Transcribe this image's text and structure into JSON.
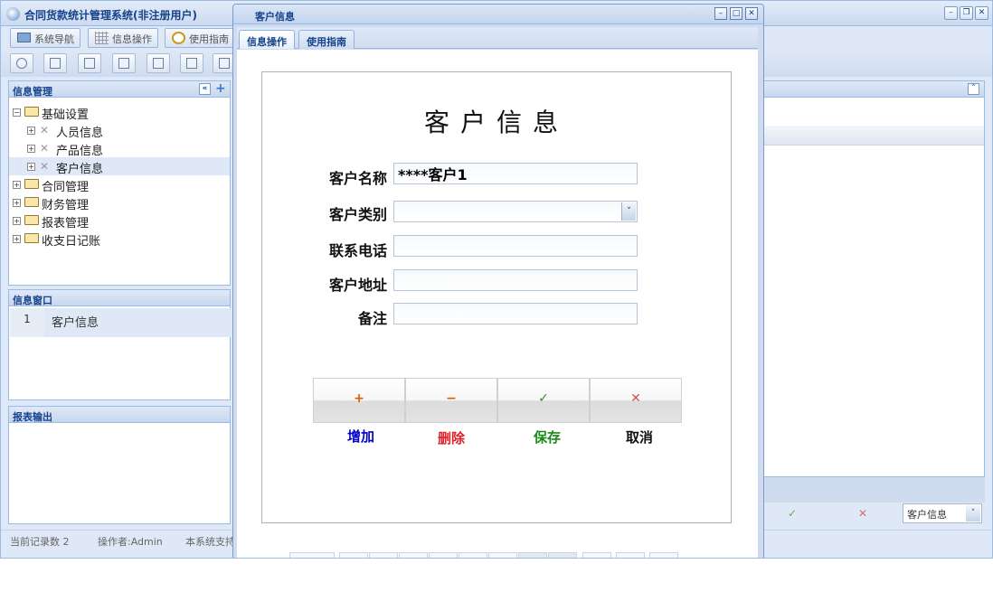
{
  "app": {
    "title": "合同货款统计管理系统(非注册用户)",
    "colors": {
      "accent": "#15428b",
      "panel": "#dfe8f6",
      "border": "#99bbe8"
    }
  },
  "menu": {
    "items": [
      {
        "label": "系统导航",
        "icon": "monitor-icon"
      },
      {
        "label": "信息操作",
        "icon": "grid-icon"
      },
      {
        "label": "使用指南",
        "icon": "clock-icon"
      }
    ]
  },
  "toolbar": {
    "tools": [
      "search-icon",
      "list-icon",
      "document-icon",
      "users-icon",
      "window-icon",
      "export-icon",
      "print-icon"
    ]
  },
  "panels": {
    "info_mgmt": {
      "title": "信息管理",
      "tree": [
        {
          "label": "基础设置",
          "level": 0,
          "type": "folder",
          "expand": "-"
        },
        {
          "label": "人员信息",
          "level": 1,
          "type": "tool",
          "expand": "+"
        },
        {
          "label": "产品信息",
          "level": 1,
          "type": "tool",
          "expand": "+"
        },
        {
          "label": "客户信息",
          "level": 1,
          "type": "tool",
          "expand": "+",
          "selected": true
        },
        {
          "label": "合同管理",
          "level": 0,
          "type": "folder",
          "expand": "+"
        },
        {
          "label": "财务管理",
          "level": 0,
          "type": "folder",
          "expand": "+"
        },
        {
          "label": "报表管理",
          "level": 0,
          "type": "folder",
          "expand": "+"
        },
        {
          "label": "收支日记账",
          "level": 0,
          "type": "folder",
          "expand": "+"
        }
      ]
    },
    "info_window": {
      "title": "信息窗口",
      "rows": [
        {
          "num": "1",
          "text": "客户信息"
        }
      ]
    },
    "report_output": {
      "title": "报表输出"
    }
  },
  "status": {
    "records": "当前记录数 2",
    "operator": "操作者:Admin",
    "support": "本系统支持"
  },
  "right_panel": {
    "select_value": "客户信息"
  },
  "modal": {
    "title": "客户信息",
    "tabs": [
      "信息操作",
      "使用指南"
    ],
    "form": {
      "heading": "客户信息",
      "fields": {
        "name": {
          "label": "客户名称",
          "value": "****客户1"
        },
        "category": {
          "label": "客户类别",
          "value": ""
        },
        "phone": {
          "label": "联系电话",
          "value": ""
        },
        "address": {
          "label": "客户地址",
          "value": ""
        },
        "remark": {
          "label": "备注",
          "value": ""
        }
      },
      "actions": [
        {
          "key": "add",
          "label": "增加",
          "icon": "+",
          "color": "#0000cc",
          "icon_color": "#e05a00"
        },
        {
          "key": "delete",
          "label": "删除",
          "icon": "−",
          "color": "#e0202a",
          "icon_color": "#e05a00"
        },
        {
          "key": "save",
          "label": "保存",
          "icon": "✓",
          "color": "#188a1a",
          "icon_color": "#3a8a3a"
        },
        {
          "key": "cancel",
          "label": "取消",
          "icon": "✕",
          "color": "#111111",
          "icon_color": "#d05050"
        }
      ]
    }
  }
}
